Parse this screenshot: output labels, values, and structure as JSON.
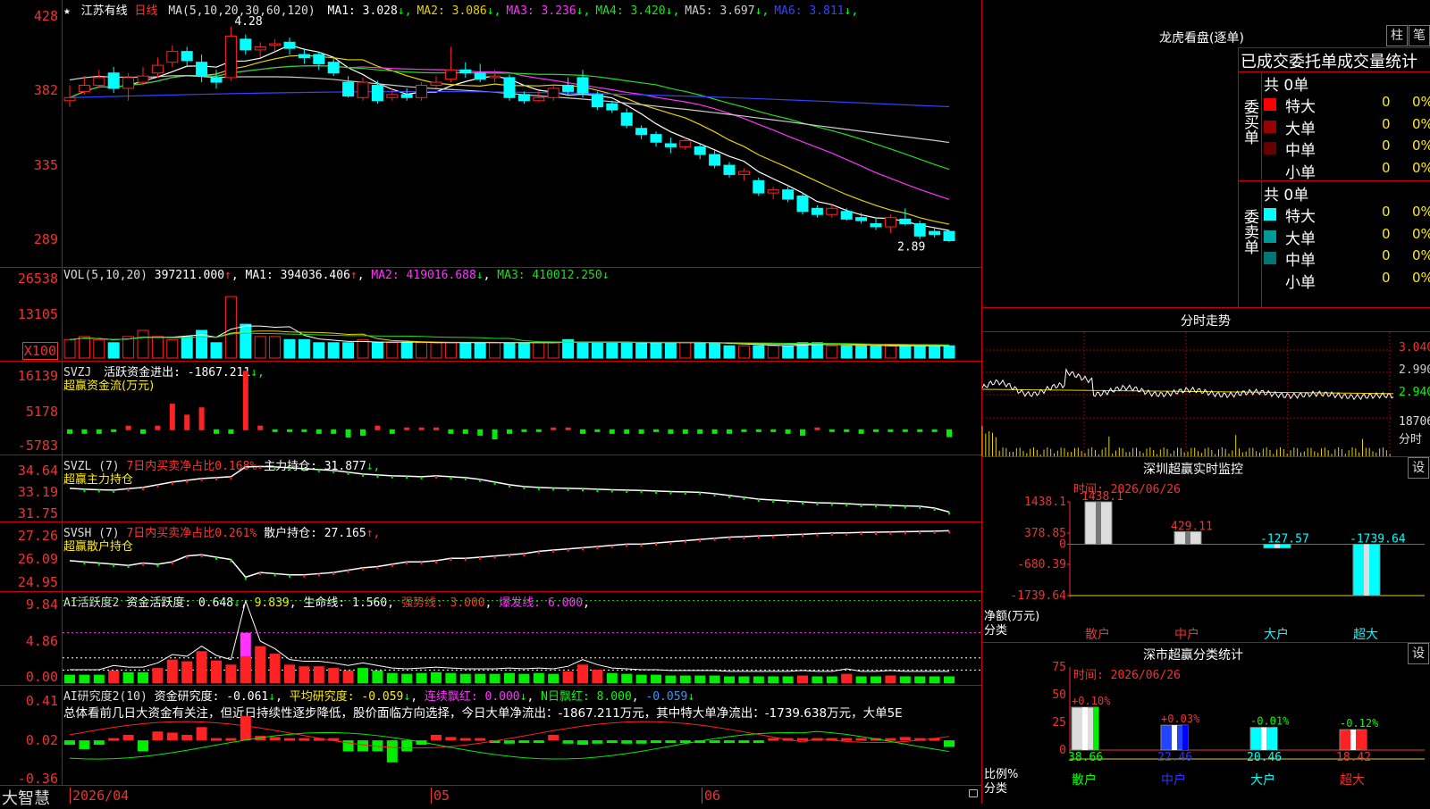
{
  "stock": {
    "star": "★",
    "name": "江苏有线",
    "period": "日线",
    "ma_title": "MA(5,10,20,30,60,120)",
    "ma_items": [
      {
        "label": "MA1: 3.028",
        "arrow": "↓",
        "color": "#ffffff"
      },
      {
        "label": "MA2: 3.086",
        "arrow": "↓",
        "color": "#e6d200"
      },
      {
        "label": "MA3: 3.236",
        "arrow": "↓",
        "color": "#ff33ff"
      },
      {
        "label": "MA4: 3.420",
        "arrow": "↓",
        "color": "#22dd22"
      },
      {
        "label": "MA5: 3.697",
        "arrow": "↓",
        "color": "#cccccc"
      },
      {
        "label": "MA6: 3.811",
        "arrow": "↓",
        "color": "#3344ff"
      }
    ],
    "high_mark": "4.28",
    "low_mark": "2.89"
  },
  "colors": {
    "up": "#ff2222",
    "down": "#00ffff",
    "grid": "#cc0000",
    "bull": "#ff2222",
    "bear": "#00ee00"
  },
  "price_axis": [
    "428",
    "382",
    "335",
    "289"
  ],
  "vol": {
    "title": "VOL(5,10,20)",
    "value": "397211.000",
    "value_arrow": "↑",
    "ma1": "MA1: 394036.406",
    "ma1_arrow": "↑",
    "ma2": "MA2: 419016.688",
    "ma2_arrow": "↓",
    "ma3": "MA3: 410012.250",
    "ma3_arrow": "↓",
    "axis": [
      "26538",
      "13105",
      "X100"
    ]
  },
  "svzj": {
    "title": "SVZJ",
    "line1": "活跃资金进出: -1867.211",
    "line1_arrow": "↓,",
    "line2": "超赢资金流(万元)",
    "axis": [
      "16139",
      "5178",
      "-5783"
    ]
  },
  "svzl": {
    "title": "SVZL (7)",
    "a": "7日内买卖净占比0.168%",
    "b": "主力持仓: 31.877",
    "b_arrow": "↓,",
    "line2": "超赢主力持仓",
    "axis": [
      "34.64",
      "33.19",
      "31.75"
    ]
  },
  "svsh": {
    "title": "SVSH (7)",
    "a": "7日内买卖净占比0.261%",
    "b": "散户持仓: 27.165",
    "b_arrow": "↑,",
    "line2": "超赢散户持仓",
    "axis": [
      "27.26",
      "26.09",
      "24.95"
    ]
  },
  "ai1": {
    "title": "AI活跃度2",
    "a": "资金活跃度: 0.648",
    "a_arrow": "↓",
    "b": "9.839",
    "c": "生命线: 1.560",
    "d": "强势线: 3.000",
    "e": "爆发线: 6.000",
    "axis": [
      "9.84",
      "4.86",
      "0.00"
    ]
  },
  "ai2": {
    "title": "AI研究度2(10)",
    "a": "资金研究度: -0.061",
    "a_arrow": "↓",
    "b": "平均研究度: -0.059",
    "b_arrow": "↓",
    "c": "连续飘红: 0.000",
    "c_arrow": "↓",
    "d": "N日飘红: 8.000",
    "e": "-0.059",
    "e_arrow": "↓",
    "summary": "总体看前几日大资金有关注，但近日持续性逐步降低，股价面临方向选择，今日大单净流出：-1867.211万元，其中特大单净流出：-1739.638万元，大单5E",
    "axis": [
      "0.41",
      "0.02",
      "-0.36"
    ]
  },
  "bottom": {
    "brand": "大智慧",
    "dates": [
      "2026/04",
      "05",
      "06"
    ]
  },
  "right": {
    "longhu_title": "龙虎看盘(逐单)",
    "btn_a": "柱",
    "btn_b": "笔",
    "stat_title": "已成交委托单成交量统计",
    "buy_label": "委买单",
    "sell_label": "委卖单",
    "buy_total": "共 0单",
    "sell_total": "共 0单",
    "rows_buy": [
      {
        "name": "特大",
        "v": "0",
        "p": "0%",
        "color": "#ff0000"
      },
      {
        "name": "大单",
        "v": "0",
        "p": "0%",
        "color": "#990000"
      },
      {
        "name": "中单",
        "v": "0",
        "p": "0%",
        "color": "#660000"
      },
      {
        "name": "小单",
        "v": "0",
        "p": "0%",
        "color": ""
      }
    ],
    "rows_sell": [
      {
        "name": "特大",
        "v": "0",
        "p": "0%",
        "color": "#00ffff"
      },
      {
        "name": "大单",
        "v": "0",
        "p": "0%",
        "color": "#009999"
      },
      {
        "name": "中单",
        "v": "0",
        "p": "0%",
        "color": "#007777"
      },
      {
        "name": "小单",
        "v": "0",
        "p": "0%",
        "color": ""
      }
    ],
    "intraday_title": "分时走势",
    "intraday_axis": [
      "3.040",
      "2.990",
      "2.940",
      "18706",
      "分时"
    ],
    "monitor_title": "深圳超赢实时监控",
    "monitor_btn": "设",
    "monitor_time": "时间: 2026/06/26",
    "monitor_axis": [
      "1438.1",
      "378.85",
      "0",
      "-680.39",
      "-1739.64"
    ],
    "monitor_ylabel": "净额(万元)",
    "monitor_xlabel": "分类",
    "monitor_cats": [
      "散户",
      "中户",
      "大户",
      "超大"
    ],
    "monitor_vals": [
      1438.1,
      429.11,
      -127.57,
      -1739.64
    ],
    "monitor_val_labels": [
      "1438.1",
      "429.11",
      "-127.57",
      "-1739.64"
    ],
    "class_title": "深市超赢分类统计",
    "class_btn": "设",
    "class_time": "时间: 2026/06/26",
    "class_axis": [
      "75",
      "50",
      "25",
      "0"
    ],
    "class_ylabel": "比例%",
    "class_xlabel": "分类",
    "class_cats": [
      "散户",
      "中户",
      "大户",
      "超大"
    ],
    "class_vals": [
      38.66,
      22.46,
      20.46,
      18.42
    ],
    "class_val_labels": [
      "38.66",
      "22.46",
      "20.46",
      "18.42"
    ],
    "class_chg": [
      "+0.10%",
      "+0.03%",
      "-0.01%",
      "-0.12%"
    ]
  },
  "chart_data": [
    {
      "type": "candlestick",
      "ylim": [
        2.8,
        4.35
      ],
      "candles": [
        [
          3.8,
          3.82,
          3.9,
          3.76
        ],
        [
          3.86,
          3.9,
          3.96,
          3.84
        ],
        [
          3.9,
          3.95,
          4.0,
          3.88
        ],
        [
          3.98,
          3.88,
          4.02,
          3.85
        ],
        [
          3.88,
          3.95,
          3.98,
          3.8
        ],
        [
          3.92,
          3.96,
          4.02,
          3.9
        ],
        [
          3.98,
          4.03,
          4.08,
          3.95
        ],
        [
          4.05,
          4.12,
          4.16,
          4.02
        ],
        [
          4.12,
          4.06,
          4.15,
          4.02
        ],
        [
          4.05,
          3.96,
          4.1,
          3.92
        ],
        [
          3.95,
          3.92,
          4.0,
          3.88
        ],
        [
          3.95,
          4.22,
          4.28,
          3.93
        ],
        [
          4.2,
          4.13,
          4.23,
          4.1
        ],
        [
          4.13,
          4.15,
          4.18,
          4.08
        ],
        [
          4.16,
          4.17,
          4.2,
          4.12
        ],
        [
          4.18,
          4.14,
          4.21,
          4.1
        ],
        [
          4.1,
          4.08,
          4.14,
          4.04
        ],
        [
          4.1,
          4.04,
          4.12,
          4.0
        ],
        [
          4.05,
          3.98,
          4.08,
          3.96
        ],
        [
          3.92,
          3.83,
          3.96,
          3.82
        ],
        [
          3.82,
          3.92,
          3.95,
          3.8
        ],
        [
          3.9,
          3.8,
          3.93,
          3.78
        ],
        [
          3.82,
          3.84,
          3.88,
          3.8
        ],
        [
          3.84,
          3.82,
          3.88,
          3.8
        ],
        [
          3.82,
          3.9,
          3.92,
          3.8
        ],
        [
          3.9,
          3.92,
          3.96,
          3.88
        ],
        [
          3.94,
          4.0,
          4.15,
          3.92
        ],
        [
          4.0,
          3.98,
          4.05,
          3.95
        ],
        [
          3.98,
          3.94,
          4.04,
          3.92
        ],
        [
          3.95,
          3.96,
          4.0,
          3.92
        ],
        [
          3.95,
          3.82,
          3.97,
          3.8
        ],
        [
          3.84,
          3.8,
          3.86,
          3.78
        ],
        [
          3.8,
          3.82,
          3.86,
          3.79
        ],
        [
          3.82,
          3.88,
          3.9,
          3.8
        ],
        [
          3.9,
          3.86,
          3.95,
          3.84
        ],
        [
          3.95,
          3.85,
          4.0,
          3.82
        ],
        [
          3.84,
          3.76,
          3.86,
          3.74
        ],
        [
          3.78,
          3.74,
          3.8,
          3.72
        ],
        [
          3.72,
          3.64,
          3.75,
          3.62
        ],
        [
          3.62,
          3.58,
          3.64,
          3.55
        ],
        [
          3.58,
          3.53,
          3.6,
          3.5
        ],
        [
          3.52,
          3.5,
          3.56,
          3.46
        ],
        [
          3.5,
          3.54,
          3.56,
          3.48
        ],
        [
          3.5,
          3.45,
          3.52,
          3.42
        ],
        [
          3.45,
          3.38,
          3.48,
          3.36
        ],
        [
          3.38,
          3.32,
          3.4,
          3.3
        ],
        [
          3.32,
          3.34,
          3.36,
          3.28
        ],
        [
          3.28,
          3.2,
          3.3,
          3.18
        ],
        [
          3.2,
          3.22,
          3.24,
          3.16
        ],
        [
          3.22,
          3.16,
          3.24,
          3.14
        ],
        [
          3.18,
          3.08,
          3.2,
          3.06
        ],
        [
          3.1,
          3.06,
          3.12,
          3.04
        ],
        [
          3.06,
          3.1,
          3.12,
          3.04
        ],
        [
          3.08,
          3.03,
          3.1,
          3.02
        ],
        [
          3.04,
          3.02,
          3.07,
          3.0
        ],
        [
          3.0,
          2.98,
          3.04,
          2.96
        ],
        [
          2.98,
          3.04,
          3.06,
          2.94
        ],
        [
          3.03,
          3.0,
          3.1,
          2.99
        ],
        [
          3.0,
          2.92,
          3.02,
          2.9
        ],
        [
          2.95,
          2.93,
          2.97,
          2.91
        ],
        [
          2.95,
          2.89,
          2.96,
          2.88
        ]
      ]
    },
    {
      "type": "bar",
      "title": "VOL",
      "values": [
        6,
        7,
        6,
        5,
        7,
        9,
        7,
        6,
        7,
        9,
        5,
        20,
        11,
        7,
        7,
        6,
        6,
        5,
        5,
        5,
        6,
        5,
        5,
        5,
        5,
        5,
        5,
        5,
        5,
        5,
        5,
        5,
        5,
        5,
        6,
        5,
        5,
        5,
        5,
        5,
        5,
        5,
        5,
        5,
        5,
        4,
        4,
        4,
        4,
        4,
        5,
        5,
        4,
        4,
        4,
        4,
        4,
        4,
        4,
        4,
        4
      ],
      "ylim": [
        0,
        27
      ]
    },
    {
      "type": "bar",
      "title": "SVZJ",
      "values": [
        -1,
        -1,
        -1,
        -0.5,
        1,
        -1,
        1,
        7,
        4,
        6,
        -1,
        -1,
        16,
        1,
        -0.5,
        -0.5,
        -0.5,
        -1,
        -1,
        -2,
        -1.5,
        1,
        -1,
        0.5,
        0.5,
        0.5,
        -1,
        -1,
        -1.5,
        -2.5,
        -1,
        -0.5,
        -0.5,
        0.5,
        0.5,
        -1,
        -0.5,
        -1,
        -1,
        -1,
        -0.5,
        -1,
        -1,
        -1,
        -1,
        -1,
        -0.5,
        -0.5,
        -0.5,
        -1,
        -1.5,
        0.5,
        -0.5,
        -0.5,
        -1,
        -0.5,
        -0.5,
        -0.5,
        -0.5,
        -0.5,
        -1.9
      ],
      "ylim": [
        -5.8,
        16.2
      ]
    },
    {
      "type": "line",
      "title": "SVZL",
      "values": [
        33.2,
        33.15,
        33.12,
        33.1,
        33.18,
        33.25,
        33.4,
        33.55,
        33.65,
        33.75,
        33.8,
        33.85,
        34.4,
        34.42,
        34.4,
        34.35,
        34.3,
        34.25,
        34.2,
        34.1,
        34.0,
        33.95,
        33.9,
        33.88,
        33.85,
        33.9,
        33.85,
        33.8,
        33.7,
        33.55,
        33.4,
        33.3,
        33.25,
        33.22,
        33.2,
        33.18,
        33.15,
        33.12,
        33.1,
        33.08,
        33.05,
        33.02,
        33.0,
        32.98,
        32.9,
        32.8,
        32.7,
        32.6,
        32.55,
        32.5,
        32.45,
        32.4,
        32.38,
        32.35,
        32.3,
        32.28,
        32.25,
        32.22,
        32.2,
        32.1,
        31.88
      ],
      "ylim": [
        31.75,
        34.64
      ]
    },
    {
      "type": "line",
      "title": "SVSH",
      "values": [
        25.9,
        25.85,
        25.8,
        25.75,
        25.7,
        25.8,
        25.75,
        25.85,
        26.1,
        26.15,
        26.05,
        25.95,
        25.2,
        25.4,
        25.35,
        25.3,
        25.3,
        25.35,
        25.4,
        25.5,
        25.6,
        25.65,
        25.75,
        25.85,
        25.85,
        25.9,
        26.0,
        26.0,
        26.05,
        26.1,
        26.15,
        26.2,
        26.3,
        26.35,
        26.4,
        26.45,
        26.5,
        26.55,
        26.6,
        26.6,
        26.65,
        26.7,
        26.75,
        26.8,
        26.85,
        26.9,
        26.92,
        26.95,
        26.97,
        27.0,
        27.02,
        27.05,
        27.07,
        27.08,
        27.1,
        27.11,
        27.12,
        27.13,
        27.14,
        27.15,
        27.17
      ],
      "ylim": [
        24.95,
        27.26
      ]
    },
    {
      "type": "bar",
      "title": "AI活跃度2",
      "values": [
        1,
        1,
        1,
        1.5,
        1.3,
        1.3,
        1.8,
        2.8,
        2.6,
        3.8,
        2.7,
        2.2,
        6.0,
        4.4,
        3.5,
        2.2,
        2.0,
        2.0,
        1.8,
        1.5,
        1.8,
        1.5,
        1.2,
        1.1,
        1.2,
        1.3,
        1.2,
        1.1,
        1.1,
        1.1,
        1.2,
        1.1,
        1.2,
        1.1,
        1.4,
        2.2,
        1.6,
        1.2,
        1.1,
        1.0,
        1.0,
        0.9,
        0.9,
        0.9,
        0.9,
        0.8,
        0.8,
        0.8,
        0.8,
        0.8,
        0.9,
        0.8,
        0.8,
        1.1,
        0.8,
        0.8,
        0.9,
        0.8,
        0.8,
        0.8,
        0.8
      ],
      "bull": [
        0,
        0,
        0,
        1,
        0,
        0,
        1,
        1,
        1,
        1,
        1,
        1,
        1,
        1,
        1,
        1,
        1,
        1,
        1,
        1,
        0,
        0,
        0,
        0,
        0,
        0,
        0,
        0,
        0,
        0,
        0,
        0,
        0,
        0,
        1,
        1,
        1,
        0,
        0,
        0,
        0,
        0,
        0,
        0,
        0,
        0,
        0,
        0,
        0,
        0,
        1,
        0,
        0,
        1,
        0,
        0,
        1,
        0,
        0,
        0,
        0
      ],
      "ylim": [
        0,
        10.0
      ]
    },
    {
      "type": "bar",
      "title": "AI研究度2",
      "values": [
        -0.04,
        -0.08,
        -0.04,
        0.02,
        0.05,
        -0.1,
        0.08,
        0.07,
        0.05,
        0.12,
        0.02,
        0.02,
        0.22,
        0.04,
        0.03,
        0.02,
        0.02,
        0.02,
        0.02,
        -0.1,
        -0.1,
        -0.1,
        -0.2,
        -0.1,
        -0.04,
        0.05,
        0.03,
        0.02,
        0.02,
        -0.02,
        -0.03,
        -0.02,
        -0.02,
        0.05,
        -0.03,
        -0.04,
        -0.03,
        -0.02,
        -0.03,
        -0.03,
        -0.02,
        -0.02,
        -0.02,
        -0.02,
        -0.02,
        -0.02,
        -0.02,
        -0.02,
        0.02,
        0.02,
        0.02,
        0.02,
        0.02,
        0.02,
        0.02,
        0.02,
        0.02,
        0.03,
        0.02,
        0.02,
        -0.06
      ],
      "ylim": [
        -0.38,
        0.43
      ]
    }
  ]
}
